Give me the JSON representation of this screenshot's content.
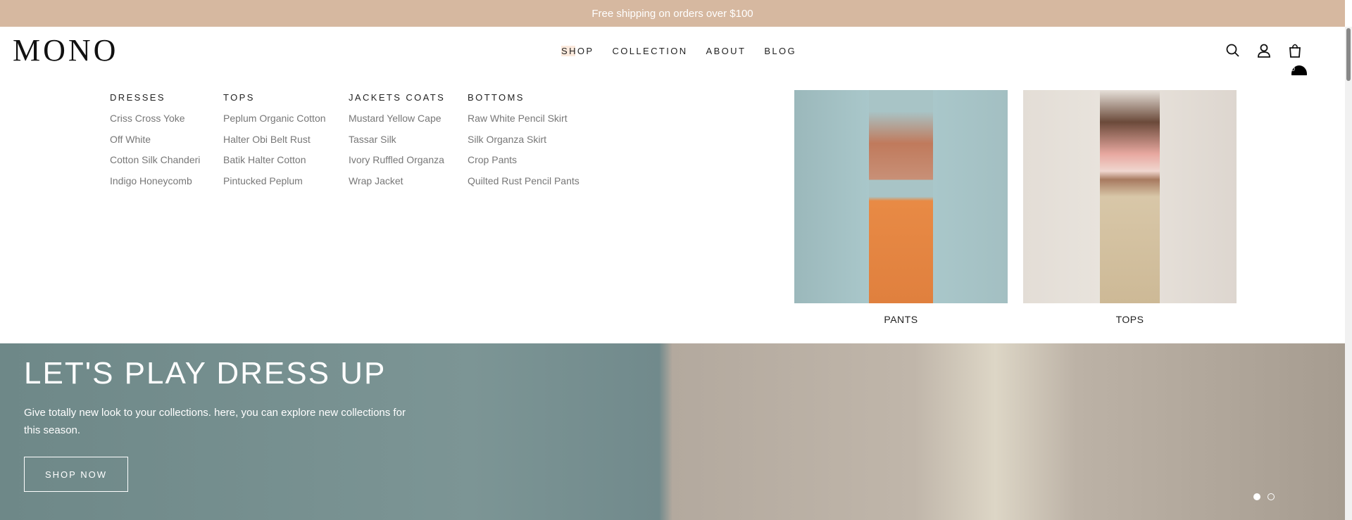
{
  "banner": {
    "text": "Free shipping on orders over $100"
  },
  "header": {
    "logo": "MONO",
    "nav": [
      {
        "label": "SHOP",
        "active": true
      },
      {
        "label": "COLLECTION"
      },
      {
        "label": "ABOUT"
      },
      {
        "label": "BLOG"
      }
    ],
    "cart_count": "0",
    "icons": [
      "search-icon",
      "user-icon",
      "bag-icon"
    ]
  },
  "mega_menu": {
    "columns": [
      {
        "heading": "DRESSES",
        "items": [
          "Criss Cross Yoke",
          "Off White",
          "Cotton Silk Chanderi",
          "Indigo Honeycomb"
        ]
      },
      {
        "heading": "TOPS",
        "items": [
          "Peplum Organic Cotton",
          "Halter Obi Belt Rust",
          "Batik Halter Cotton",
          "Pintucked Peplum"
        ]
      },
      {
        "heading": "JACKETS COATS",
        "items": [
          "Mustard Yellow Cape",
          "Tassar Silk",
          "Ivory Ruffled Organza",
          "Wrap Jacket"
        ]
      },
      {
        "heading": "BOTTOMS",
        "items": [
          "Raw White Pencil Skirt",
          "Silk Organza Skirt",
          "Crop Pants",
          "Quilted Rust Pencil Pants"
        ]
      }
    ],
    "cards": [
      {
        "label": "PANTS"
      },
      {
        "label": "TOPS"
      }
    ]
  },
  "hero": {
    "title": "LET'S PLAY DRESS UP",
    "description": "Give totally new look to your collections. here, you can explore new collections for this season.",
    "button": "SHOP NOW",
    "slides": 2,
    "active_slide": 1
  },
  "colors": {
    "banner": "#d6b8a0"
  }
}
